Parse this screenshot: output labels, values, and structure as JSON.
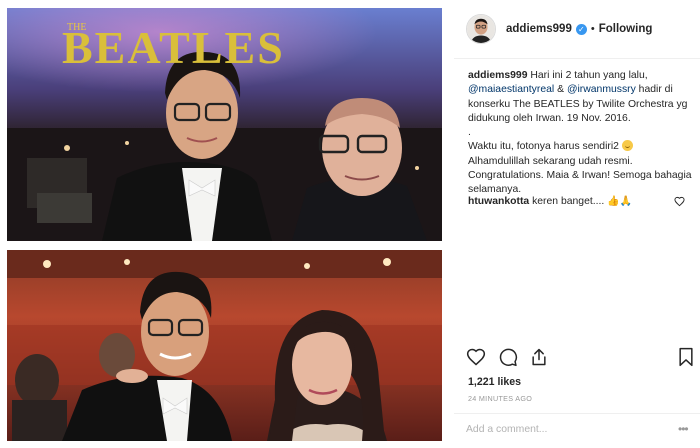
{
  "post": {
    "username": "addiems999",
    "verified_icon": "verified-badge-icon",
    "separator": "•",
    "follow_status": "Following"
  },
  "caption": {
    "username": "addiems999",
    "line1_text": " Hari ini 2 tahun yang lalu, ",
    "mention1": "@maiaestiantyreal",
    "amp": " & ",
    "mention2": "@irwanmussry",
    "line1_rest": " hadir di konserku The BEATLES by Twilite Orchestra yg didukung oleh Irwan. 19 Nov. 2016.",
    "dot_line": ".",
    "para2_a": "Waktu itu, fotonya harus sendiri2 ",
    "para2_b": "Alhamdulillah sekarang udah resmi. Congratulations. Maia & Irwan! Semoga bahagia selamanya."
  },
  "comment": {
    "username": "htuwankotta",
    "text": " keren banget.... ",
    "emojis": "👍🙏"
  },
  "actions": {
    "like_icon": "heart-icon",
    "comment_icon": "comment-icon",
    "share_icon": "share-icon",
    "save_icon": "bookmark-icon"
  },
  "likes": "1,221 likes",
  "timestamp": "24 MINUTES AGO",
  "add_comment": {
    "placeholder": "Add a comment...",
    "more": "•••"
  },
  "photos": {
    "top_banner_text": "BEATLES",
    "top_banner_small": "THE"
  },
  "colors": {
    "link": "#003569",
    "verified": "#3897f0",
    "muted": "#999999",
    "divider": "#efefef"
  }
}
